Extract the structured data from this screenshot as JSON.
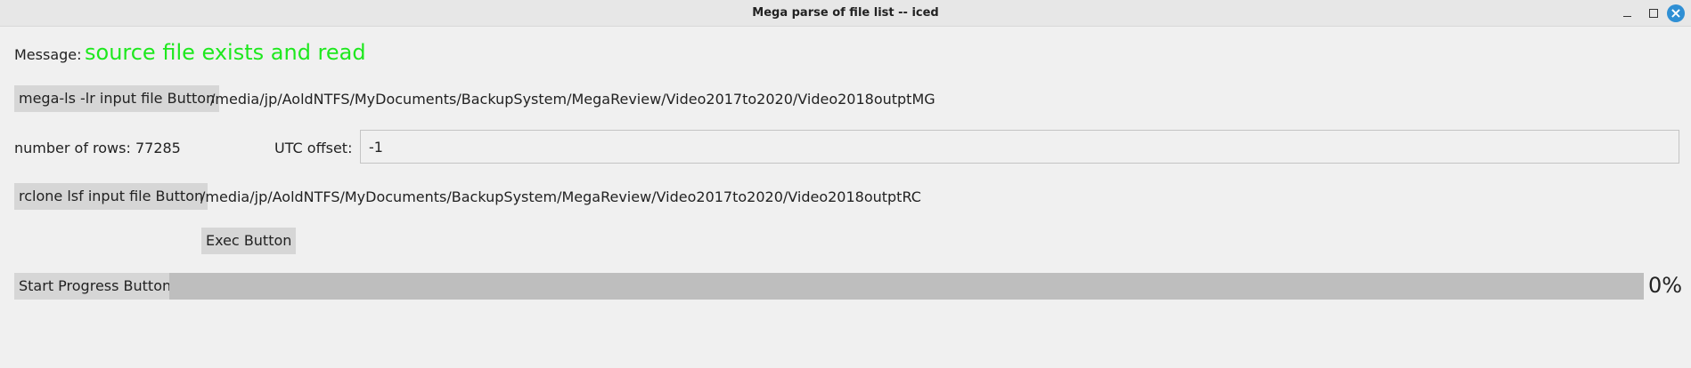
{
  "window": {
    "title": "Mega parse of file list -- iced",
    "controls": {
      "minimize": "minimize-icon",
      "maximize": "maximize-icon",
      "close": "close-icon"
    }
  },
  "message": {
    "label": "Message:",
    "value": "source file exists and read",
    "value_color": "#1ee81e"
  },
  "mega_row": {
    "button_label": "mega-ls -lr input file Button",
    "path": "/media/jp/AoldNTFS/MyDocuments/BackupSystem/MegaReview/Video2017to2020/Video2018outptMG"
  },
  "rows_row": {
    "rows_text": "number of rows: 77285",
    "utc_label": "UTC offset:",
    "utc_value": "-1"
  },
  "rclone_row": {
    "button_label": "rclone lsf input file Button",
    "path": "/media/jp/AoldNTFS/MyDocuments/BackupSystem/MegaReview/Video2017to2020/Video2018outptRC"
  },
  "exec": {
    "button_label": "Exec Button"
  },
  "progress": {
    "button_label": "Start Progress Button",
    "percent_text": "0%",
    "fraction": 0
  }
}
